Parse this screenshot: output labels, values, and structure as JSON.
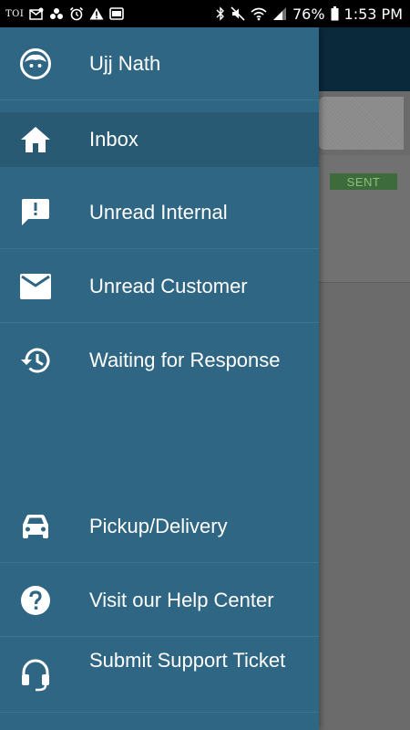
{
  "status_bar": {
    "left_icons": [
      "toi-icon",
      "mail-alert-icon",
      "dots-icon",
      "alarm-icon",
      "warning-icon",
      "screen-icon"
    ],
    "toi_text": "TOI",
    "right_icons": [
      "bluetooth-icon",
      "mute-icon",
      "wifi-icon",
      "signal-icon"
    ],
    "battery": "76%",
    "time": "1:53 PM"
  },
  "background": {
    "badge": "SENT"
  },
  "drawer": {
    "items": [
      {
        "label": "Ujj Nath",
        "icon": "user-face-icon",
        "active": false
      },
      {
        "label": "Inbox",
        "icon": "home-icon",
        "active": true
      },
      {
        "label": "Unread Internal",
        "icon": "message-alert-icon",
        "active": false
      },
      {
        "label": "Unread Customer",
        "icon": "mail-icon",
        "active": false
      },
      {
        "label": "Waiting for Response",
        "icon": "history-icon",
        "active": false
      },
      {
        "label": "Pickup/Delivery",
        "icon": "car-icon",
        "active": false
      },
      {
        "label": "Visit our Help Center",
        "icon": "help-circle-icon",
        "active": false
      },
      {
        "label": "Submit Support Ticket",
        "icon": "headset-icon",
        "active": false
      }
    ]
  }
}
